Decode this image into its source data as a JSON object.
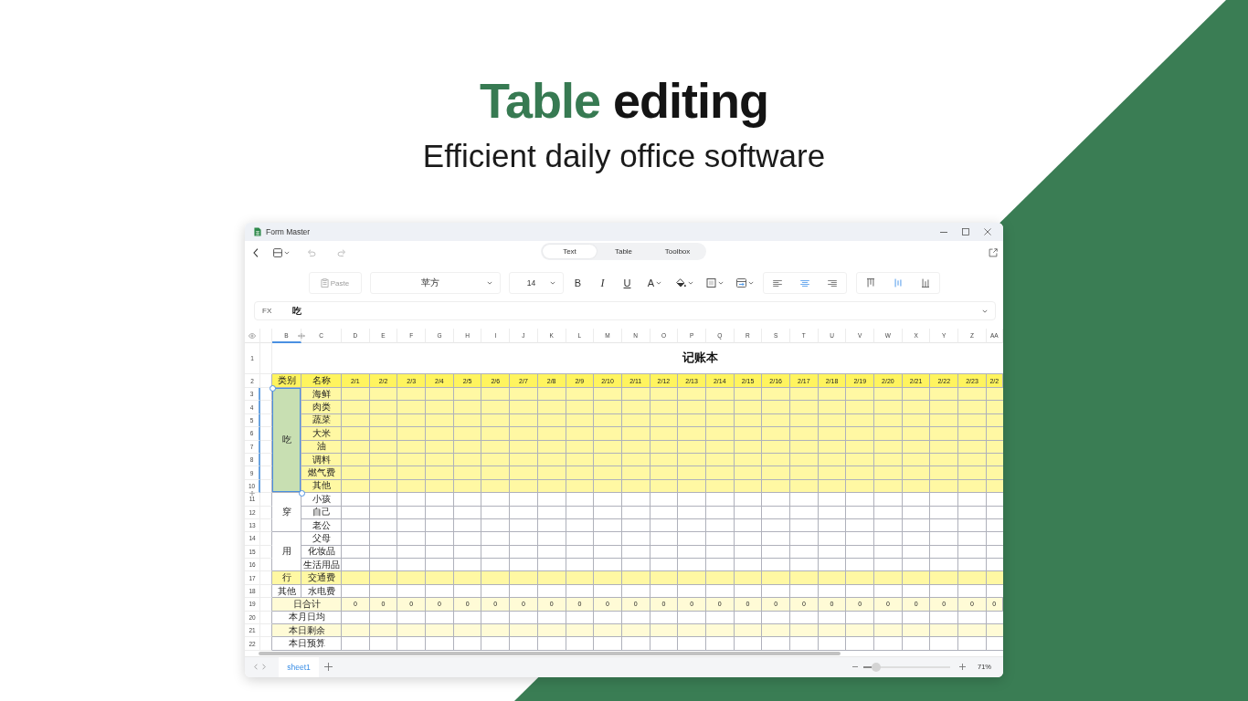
{
  "headline": {
    "accent": "Table",
    "rest": "editing"
  },
  "subtitle": "Efficient daily office software",
  "window": {
    "title": "Form Master",
    "toolbar": {
      "history": [
        {
          "kind": "undo",
          "disabled": true
        },
        {
          "kind": "redo",
          "disabled": true
        }
      ],
      "tabs": [
        {
          "label": "Text",
          "selected": true
        },
        {
          "label": "Table",
          "selected": false
        },
        {
          "label": "Toolbox",
          "selected": false
        }
      ]
    },
    "format_bar": {
      "paste": {
        "label": "Paste",
        "disabled": true
      },
      "font": {
        "value": "苹方"
      },
      "font_size": {
        "value": "14"
      },
      "text_styles": [
        {
          "kind": "bold",
          "label": "B"
        },
        {
          "kind": "italic",
          "label": "I"
        },
        {
          "kind": "underline",
          "label": "U"
        }
      ],
      "font_color": {
        "label": "A"
      },
      "horizontal_align": [
        {
          "kind": "left",
          "selected": false
        },
        {
          "kind": "center",
          "selected": true
        },
        {
          "kind": "right",
          "selected": false
        }
      ],
      "vertical_align": [
        {
          "kind": "top",
          "selected": false
        },
        {
          "kind": "middle",
          "selected": true
        },
        {
          "kind": "bottom",
          "selected": false
        }
      ]
    },
    "formula_bar": {
      "label": "FX",
      "value": "吃"
    },
    "spreadsheet": {
      "column_headers": [
        {
          "label": "B",
          "selected": true
        },
        {
          "label": "C",
          "selected": false
        },
        {
          "label": "D",
          "selected": false
        },
        {
          "label": "E",
          "selected": false
        },
        {
          "label": "F",
          "selected": false
        },
        {
          "label": "G",
          "selected": false
        },
        {
          "label": "H",
          "selected": false
        },
        {
          "label": "I",
          "selected": false
        },
        {
          "label": "J",
          "selected": false
        },
        {
          "label": "K",
          "selected": false
        },
        {
          "label": "L",
          "selected": false
        },
        {
          "label": "M",
          "selected": false
        },
        {
          "label": "N",
          "selected": false
        },
        {
          "label": "O",
          "selected": false
        },
        {
          "label": "P",
          "selected": false
        },
        {
          "label": "Q",
          "selected": false
        },
        {
          "label": "R",
          "selected": false
        },
        {
          "label": "S",
          "selected": false
        },
        {
          "label": "T",
          "selected": false
        },
        {
          "label": "U",
          "selected": false
        },
        {
          "label": "V",
          "selected": false
        },
        {
          "label": "W",
          "selected": false
        },
        {
          "label": "X",
          "selected": false
        },
        {
          "label": "Y",
          "selected": false
        },
        {
          "label": "Z",
          "selected": false
        },
        {
          "label": "AA",
          "selected": false
        }
      ],
      "row_numbers": [
        {
          "label": "1",
          "selected": false
        },
        {
          "label": "2",
          "selected": false
        },
        {
          "label": "3",
          "selected": true
        },
        {
          "label": "4",
          "selected": true
        },
        {
          "label": "5",
          "selected": true
        },
        {
          "label": "6",
          "selected": true
        },
        {
          "label": "7",
          "selected": true
        },
        {
          "label": "8",
          "selected": true
        },
        {
          "label": "9",
          "selected": true
        },
        {
          "label": "10",
          "selected": true
        },
        {
          "label": "11",
          "selected": false
        },
        {
          "label": "12",
          "selected": false
        },
        {
          "label": "13",
          "selected": false
        },
        {
          "label": "14",
          "selected": false
        },
        {
          "label": "15",
          "selected": false
        },
        {
          "label": "16",
          "selected": false
        },
        {
          "label": "17",
          "selected": false
        },
        {
          "label": "18",
          "selected": false
        },
        {
          "label": "19",
          "selected": false
        },
        {
          "label": "20",
          "selected": false
        },
        {
          "label": "21",
          "selected": false
        },
        {
          "label": "22",
          "selected": false
        }
      ],
      "title": "记账本",
      "header_row": {
        "category": "类别",
        "name": "名称",
        "dates": [
          "2/1",
          "2/2",
          "2/3",
          "2/4",
          "2/5",
          "2/6",
          "2/7",
          "2/8",
          "2/9",
          "2/10",
          "2/11",
          "2/12",
          "2/13",
          "2/14",
          "2/15",
          "2/16",
          "2/17",
          "2/18",
          "2/19",
          "2/20",
          "2/21",
          "2/22",
          "2/23",
          "2/2"
        ]
      },
      "groups": [
        {
          "category": {
            "text": "吃",
            "color": "#c8dfb2",
            "selected": true
          },
          "items": [
            {
              "name": "海鲜",
              "color": "#fff8a3"
            },
            {
              "name": "肉类",
              "color": "#fff8a3"
            },
            {
              "name": "蔬菜",
              "color": "#fff8a3"
            },
            {
              "name": "大米",
              "color": "#fff8a3"
            },
            {
              "name": "油",
              "color": "#fff8a3"
            },
            {
              "name": "调料",
              "color": "#fff8a3"
            },
            {
              "name": "燃气费",
              "color": "#fff8a3"
            },
            {
              "name": "其他",
              "color": "#fff8a3"
            }
          ]
        },
        {
          "category": {
            "text": "穿",
            "color": "#ffffff",
            "selected": false
          },
          "items": [
            {
              "name": "小孩",
              "color": "#ffffff"
            },
            {
              "name": "自己",
              "color": "#ffffff"
            },
            {
              "name": "老公",
              "color": "#ffffff"
            }
          ]
        },
        {
          "category": {
            "text": "用",
            "color": "#ffffff",
            "selected": false
          },
          "items": [
            {
              "name": "父母",
              "color": "#ffffff"
            },
            {
              "name": "化妆品",
              "color": "#ffffff"
            },
            {
              "name": "生活用品",
              "color": "#ffffff"
            }
          ]
        },
        {
          "category": {
            "text": "行",
            "color": "#fff8a3",
            "selected": false
          },
          "items": [
            {
              "name": "交通费",
              "color": "#fff8a3"
            }
          ]
        },
        {
          "category": {
            "text": "其他",
            "color": "#ffffff",
            "selected": false
          },
          "items": [
            {
              "name": "水电费",
              "color": "#ffffff"
            }
          ]
        }
      ],
      "summary_rows": [
        {
          "label": "日合计",
          "color": "#fffbd6",
          "values": [
            "0",
            "0",
            "0",
            "0",
            "0",
            "0",
            "0",
            "0",
            "0",
            "0",
            "0",
            "0",
            "0",
            "0",
            "0",
            "0",
            "0",
            "0",
            "0",
            "0",
            "0",
            "0",
            "0",
            "0"
          ]
        },
        {
          "label": "本月日均",
          "color": "#ffffff"
        },
        {
          "label": "本日剩余",
          "color": "#fffbd6"
        },
        {
          "label": "本日预算",
          "color": "#ffffff"
        }
      ]
    },
    "sheet_tabs": [
      {
        "label": "sheet1",
        "selected": true
      }
    ],
    "zoom": {
      "level": 0.15,
      "reading": "71%"
    }
  }
}
